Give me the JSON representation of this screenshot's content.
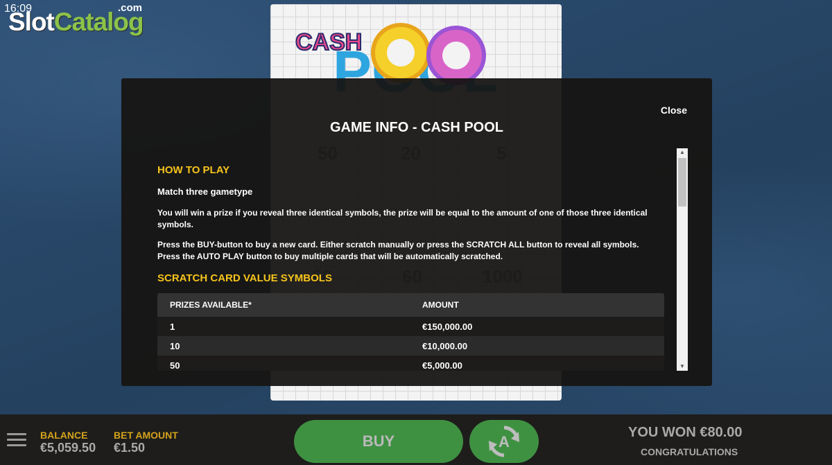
{
  "status": {
    "time": "16:09"
  },
  "watermark": {
    "part1": "Slot",
    "part2": "Catalog",
    "suffix": ".com"
  },
  "game_card": {
    "logo_word1": "CASH",
    "logo_word2": "POOL",
    "bg_values": [
      "50",
      "20",
      "5",
      "50",
      "60",
      "1000"
    ]
  },
  "modal": {
    "title": "GAME INFO - CASH POOL",
    "close_label": "Close",
    "how_to_play": {
      "heading": "HOW TO PLAY",
      "subheading": "Match three gametype",
      "para1": "You will win a prize if you reveal three identical symbols, the prize will be equal to the amount of one of those three identical symbols.",
      "para2": "Press the BUY-button to buy a new card. Either scratch manually or press the SCRATCH ALL button to reveal all symbols. Press the AUTO PLAY button to buy multiple cards that will be automatically scratched."
    },
    "symbols": {
      "heading": "SCRATCH CARD VALUE SYMBOLS",
      "columns": [
        "PRIZES AVAILABLE*",
        "AMOUNT"
      ],
      "rows": [
        {
          "prizes": "1",
          "amount": "€150,000.00"
        },
        {
          "prizes": "10",
          "amount": "€10,000.00"
        },
        {
          "prizes": "50",
          "amount": "€5,000.00"
        }
      ]
    }
  },
  "bottom_bar": {
    "balance_label": "BALANCE",
    "balance_value": "€5,059.50",
    "bet_label": "BET AMOUNT",
    "bet_value": "€1.50",
    "buy_label": "BUY",
    "won_text": "YOU WON €80.00",
    "congrats": "CONGRATULATIONS"
  },
  "colors": {
    "accent_yellow": "#f6c41c",
    "button_green": "#3f9142",
    "background_blue": "#2b4a6e"
  }
}
